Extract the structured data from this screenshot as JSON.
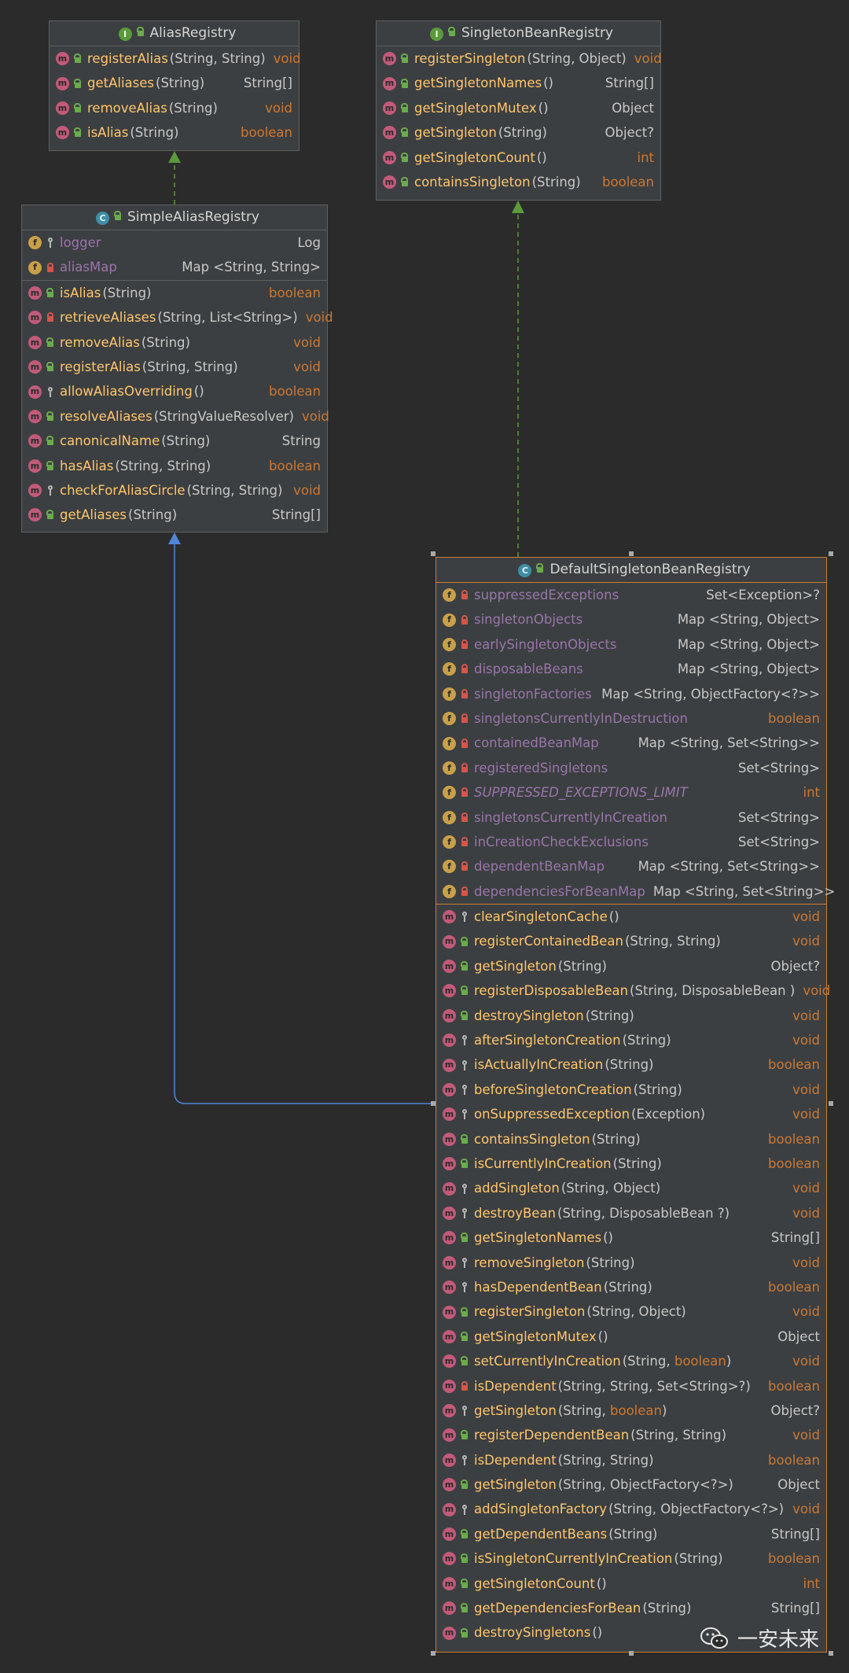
{
  "classes": {
    "alias_registry": {
      "kind": "I",
      "title": "AliasRegistry",
      "methods": [
        {
          "name": "registerAlias",
          "params": "(String, String)",
          "ret": "void",
          "vis": "pub"
        },
        {
          "name": "getAliases",
          "params": "(String)",
          "ret": "String[]",
          "vis": "pub"
        },
        {
          "name": "removeAlias",
          "params": "(String)",
          "ret": "void",
          "vis": "pub"
        },
        {
          "name": "isAlias",
          "params": "(String)",
          "ret": "boolean",
          "vis": "pub"
        }
      ]
    },
    "singleton_bean_registry": {
      "kind": "I",
      "title": "SingletonBeanRegistry",
      "methods": [
        {
          "name": "registerSingleton",
          "params": "(String, Object)",
          "ret": "void",
          "vis": "pub"
        },
        {
          "name": "getSingletonNames",
          "params": "()",
          "ret": "String[]",
          "vis": "pub"
        },
        {
          "name": "getSingletonMutex",
          "params": "()",
          "ret": "Object",
          "vis": "pub"
        },
        {
          "name": "getSingleton",
          "params": "(String)",
          "ret": "Object?",
          "vis": "pub"
        },
        {
          "name": "getSingletonCount",
          "params": "()",
          "ret": "int",
          "vis": "pub"
        },
        {
          "name": "containsSingleton",
          "params": "(String)",
          "ret": "boolean",
          "vis": "pub"
        }
      ]
    },
    "simple_alias_registry": {
      "kind": "C",
      "title": "SimpleAliasRegistry",
      "fields": [
        {
          "name": "logger",
          "type": "Log",
          "vis": "prot"
        },
        {
          "name": "aliasMap",
          "type": "Map <String, String>",
          "vis": "priv"
        }
      ],
      "methods": [
        {
          "name": "isAlias",
          "params": "(String)",
          "ret": "boolean",
          "vis": "pub"
        },
        {
          "name": "retrieveAliases",
          "params": "(String, List<String>)",
          "ret": "void",
          "vis": "priv"
        },
        {
          "name": "removeAlias",
          "params": "(String)",
          "ret": "void",
          "vis": "pub"
        },
        {
          "name": "registerAlias",
          "params": "(String, String)",
          "ret": "void",
          "vis": "pub"
        },
        {
          "name": "allowAliasOverriding",
          "params": "()",
          "ret": "boolean",
          "vis": "prot"
        },
        {
          "name": "resolveAliases",
          "params": "(StringValueResolver)",
          "ret": "void",
          "vis": "pub"
        },
        {
          "name": "canonicalName",
          "params": "(String)",
          "ret": "String",
          "vis": "pub"
        },
        {
          "name": "hasAlias",
          "params": "(String, String)",
          "ret": "boolean",
          "vis": "pub"
        },
        {
          "name": "checkForAliasCircle",
          "params": "(String, String)",
          "ret": "void",
          "vis": "prot"
        },
        {
          "name": "getAliases",
          "params": "(String)",
          "ret": "String[]",
          "vis": "pub"
        }
      ]
    },
    "default_singleton_bean_registry": {
      "kind": "C",
      "title": "DefaultSingletonBeanRegistry",
      "fields": [
        {
          "name": "suppressedExceptions",
          "type": "Set<Exception>?",
          "vis": "priv"
        },
        {
          "name": "singletonObjects",
          "type": "Map <String, Object>",
          "vis": "priv"
        },
        {
          "name": "earlySingletonObjects",
          "type": "Map <String, Object>",
          "vis": "priv"
        },
        {
          "name": "disposableBeans",
          "type": "Map <String, Object>",
          "vis": "priv"
        },
        {
          "name": "singletonFactories",
          "type": "Map <String, ObjectFactory<?>>",
          "vis": "priv"
        },
        {
          "name": "singletonsCurrentlyInDestruction",
          "type": "boolean",
          "vis": "priv"
        },
        {
          "name": "containedBeanMap",
          "type": "Map <String, Set<String>>",
          "vis": "priv"
        },
        {
          "name": "registeredSingletons",
          "type": "Set<String>",
          "vis": "priv"
        },
        {
          "name": "SUPPRESSED_EXCEPTIONS_LIMIT",
          "type": "int",
          "vis": "priv"
        },
        {
          "name": "singletonsCurrentlyInCreation",
          "type": "Set<String>",
          "vis": "priv"
        },
        {
          "name": "inCreationCheckExclusions",
          "type": "Set<String>",
          "vis": "priv"
        },
        {
          "name": "dependentBeanMap",
          "type": "Map <String, Set<String>>",
          "vis": "priv"
        },
        {
          "name": "dependenciesForBeanMap",
          "type": "Map <String, Set<String>>",
          "vis": "priv"
        }
      ],
      "methods": [
        {
          "name": "clearSingletonCache",
          "params": "()",
          "ret": "void",
          "vis": "prot"
        },
        {
          "name": "registerContainedBean",
          "params": "(String, String)",
          "ret": "void",
          "vis": "pub"
        },
        {
          "name": "getSingleton",
          "params": "(String)",
          "ret": "Object?",
          "vis": "pub"
        },
        {
          "name": "registerDisposableBean",
          "params": "(String, DisposableBean )",
          "ret": "void",
          "vis": "pub"
        },
        {
          "name": "destroySingleton",
          "params": "(String)",
          "ret": "void",
          "vis": "pub"
        },
        {
          "name": "afterSingletonCreation",
          "params": "(String)",
          "ret": "void",
          "vis": "prot"
        },
        {
          "name": "isActuallyInCreation",
          "params": "(String)",
          "ret": "boolean",
          "vis": "prot"
        },
        {
          "name": "beforeSingletonCreation",
          "params": "(String)",
          "ret": "void",
          "vis": "prot"
        },
        {
          "name": "onSuppressedException",
          "params": "(Exception)",
          "ret": "void",
          "vis": "prot"
        },
        {
          "name": "containsSingleton",
          "params": "(String)",
          "ret": "boolean",
          "vis": "pub"
        },
        {
          "name": "isCurrentlyInCreation",
          "params": "(String)",
          "ret": "boolean",
          "vis": "pub"
        },
        {
          "name": "addSingleton",
          "params": "(String, Object)",
          "ret": "void",
          "vis": "prot"
        },
        {
          "name": "destroyBean",
          "params": "(String, DisposableBean ?)",
          "ret": "void",
          "vis": "prot"
        },
        {
          "name": "getSingletonNames",
          "params": "()",
          "ret": "String[]",
          "vis": "pub"
        },
        {
          "name": "removeSingleton",
          "params": "(String)",
          "ret": "void",
          "vis": "prot"
        },
        {
          "name": "hasDependentBean",
          "params": "(String)",
          "ret": "boolean",
          "vis": "prot"
        },
        {
          "name": "registerSingleton",
          "params": "(String, Object)",
          "ret": "void",
          "vis": "pub"
        },
        {
          "name": "getSingletonMutex",
          "params": "()",
          "ret": "Object",
          "vis": "pub"
        },
        {
          "name": "setCurrentlyInCreation",
          "params": "(String, boolean)",
          "ret": "void",
          "vis": "pub"
        },
        {
          "name": "isDependent",
          "params": "(String, String, Set<String>?)",
          "ret": "boolean",
          "vis": "priv"
        },
        {
          "name": "getSingleton",
          "params": "(String, boolean)",
          "ret": "Object?",
          "vis": "prot"
        },
        {
          "name": "registerDependentBean",
          "params": "(String, String)",
          "ret": "void",
          "vis": "pub"
        },
        {
          "name": "isDependent",
          "params": "(String, String)",
          "ret": "boolean",
          "vis": "prot"
        },
        {
          "name": "getSingleton",
          "params": "(String, ObjectFactory<?>)",
          "ret": "Object",
          "vis": "pub"
        },
        {
          "name": "addSingletonFactory",
          "params": "(String, ObjectFactory<?>)",
          "ret": "void",
          "vis": "prot"
        },
        {
          "name": "getDependentBeans",
          "params": "(String)",
          "ret": "String[]",
          "vis": "pub"
        },
        {
          "name": "isSingletonCurrentlyInCreation",
          "params": "(String)",
          "ret": "boolean",
          "vis": "pub"
        },
        {
          "name": "getSingletonCount",
          "params": "()",
          "ret": "int",
          "vis": "pub"
        },
        {
          "name": "getDependenciesForBean",
          "params": "(String)",
          "ret": "String[]",
          "vis": "pub"
        },
        {
          "name": "destroySingletons",
          "params": "()",
          "ret": "",
          "vis": "pub"
        }
      ]
    }
  },
  "keywords": [
    "void",
    "boolean",
    "int"
  ],
  "colors": {
    "background": "#2b2b2b",
    "method_name": "#ffc66d",
    "field_name": "#9876aa",
    "keyword": "#cc7832",
    "implements_arrow": "#5b9a3c",
    "extends_arrow": "#4f86d8",
    "selection_border": "#c97d33"
  },
  "watermark": "一安未来"
}
